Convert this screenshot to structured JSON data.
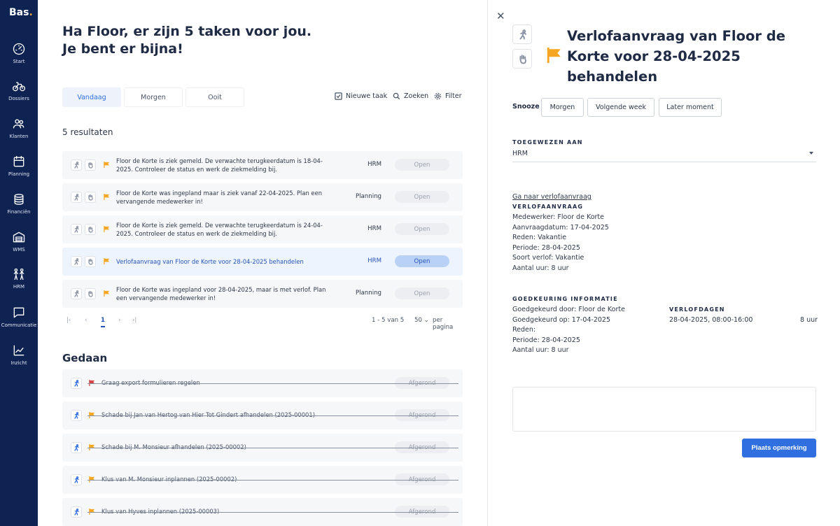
{
  "app": {
    "logo": "Bas",
    "logo_dot": "."
  },
  "sidebar": {
    "items": [
      {
        "label": "Start",
        "icon": "gauge-icon"
      },
      {
        "label": "Dossiers",
        "icon": "bicycle-icon"
      },
      {
        "label": "Klanten",
        "icon": "users-icon"
      },
      {
        "label": "Planning",
        "icon": "calendar-icon"
      },
      {
        "label": "Financiën",
        "icon": "coins-icon"
      },
      {
        "label": "WMS",
        "icon": "warehouse-icon"
      },
      {
        "label": "HRM",
        "icon": "people-icon"
      },
      {
        "label": "Communicatie",
        "icon": "chat-icon"
      },
      {
        "label": "Inzicht",
        "icon": "chart-icon"
      }
    ]
  },
  "main": {
    "greeting": "Ha Floor, er zijn 5 taken voor jou. Je bent er bijna!",
    "tabs": [
      {
        "label": "Vandaag",
        "active": true
      },
      {
        "label": "Morgen",
        "active": false
      },
      {
        "label": "Ooit",
        "active": false
      }
    ],
    "toolbar": {
      "new_task": "Nieuwe taak",
      "search": "Zoeken",
      "filter": "Filter"
    },
    "results_count": "5 resultaten",
    "tasks": [
      {
        "text": "Floor de Korte is ziek gemeld. De verwachte terugkeerdatum is 18-04-2025. Controleer de status en werk de ziekmelding bij.",
        "category": "HRM",
        "status": "Open",
        "flag_color": "#f5a623"
      },
      {
        "text": "Floor de Korte was ingepland maar is ziek vanaf 22-04-2025. Plan een vervangende medewerker in!",
        "category": "Planning",
        "status": "Open",
        "flag_color": "#f5a623"
      },
      {
        "text": "Floor de Korte is ziek gemeld. De verwachte terugkeerdatum is 24-04-2025. Controleer de status en werk de ziekmelding bij.",
        "category": "HRM",
        "status": "Open",
        "flag_color": "#f5a623"
      },
      {
        "text": "Verlofaanvraag van Floor de Korte voor 28-04-2025 behandelen",
        "category": "HRM",
        "status": "Open",
        "flag_color": "#f5a623",
        "selected": true
      },
      {
        "text": "Floor de Korte was ingepland voor 28-04-2025, maar is met verlof. Plan een vervangende medewerker in!",
        "category": "Planning",
        "status": "Open",
        "flag_color": "#f5a623"
      }
    ],
    "pagination": {
      "first": "|‹",
      "prev": "‹",
      "current": "1",
      "next": "›",
      "last": "›|",
      "range": "1 - 5 van 5",
      "per_page": "50",
      "per_page_label": "per pagina"
    },
    "done_title": "Gedaan",
    "done_tasks": [
      {
        "text": "Graag export formulieren regelen",
        "status": "Afgerond",
        "flag_color": "#d64545"
      },
      {
        "text": "Schade bij Jan van Hertog van Hier Tot Gindert afhandelen (2025-00001)",
        "status": "Afgerond",
        "flag_color": "#f5a623"
      },
      {
        "text": "Schade bij M. Monsieur afhandelen (2025-00002)",
        "status": "Afgerond",
        "flag_color": "#f5a623"
      },
      {
        "text": "Klus van M. Monsieur inplannen (2025-00002)",
        "status": "Afgerond",
        "flag_color": "#f5a623"
      },
      {
        "text": "Klus van Hyves inplannen (2025-00003)",
        "status": "Afgerond",
        "flag_color": "#f5a623"
      }
    ]
  },
  "panel": {
    "title": "Verlofaanvraag van Floor de Korte voor 28-04-2025 behandelen",
    "snooze_label": "Snooze",
    "snooze_options": [
      "Morgen",
      "Volgende week",
      "Later moment"
    ],
    "assigned_label": "TOEGEWEZEN AAN",
    "assigned_value": "HRM",
    "link": "Ga naar verlofaanvraag",
    "request_label": "VERLOFAANVRAAG",
    "request_lines": [
      "Medewerker: Floor de Korte",
      "Aanvraagdatum: 17-04-2025",
      "Reden: Vakantie",
      "Periode: 28-04-2025",
      "Soort verlof: Vakantie",
      "Aantal uur: 8 uur"
    ],
    "approval_label": "GOEDKEURING INFORMATIE",
    "approval_lines": [
      "Goedgekeurd door: Floor de Korte",
      "Goedgekeurd op: 17-04-2025",
      "Reden:",
      "Periode: 28-04-2025",
      "Aantal uur: 8 uur"
    ],
    "leave_days_label": "VERLOFDAGEN",
    "leave_day": "28-04-2025, 08:00-16:00",
    "leave_hours": "8 uur",
    "comment_placeholder": "",
    "post_button": "Plaats opmerking",
    "flag_color": "#f5a623"
  }
}
